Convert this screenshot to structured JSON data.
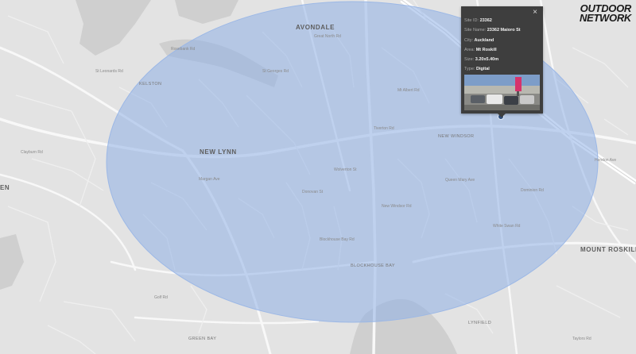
{
  "brand": {
    "line1": "OUTDOOR",
    "line2": "NETWORK"
  },
  "popup": {
    "rows": [
      {
        "key": "Site ID: ",
        "value": "23362"
      },
      {
        "key": "Site Name: ",
        "value": "23362 Maioro St"
      },
      {
        "key": "City: ",
        "value": "Auckland"
      },
      {
        "key": "Area: ",
        "value": "Mt Roskill"
      },
      {
        "key": "Size: ",
        "value": "3.20x5.40m"
      },
      {
        "key": "Type: ",
        "value": "Digital"
      }
    ],
    "close_glyph": "×"
  },
  "map": {
    "suburbs": {
      "avondale": "AVONDALE",
      "new_lynn": "NEW LYNN",
      "mount_roskill": "MOUNT ROSKILL",
      "blockhouse_bay": "BLOCKHOUSE BAY",
      "new_windsor": "NEW WINDSOR",
      "kelston": "KELSTON",
      "lynfield": "LYNFIELD",
      "green_bay": "GREEN BAY",
      "edge_en": "EN"
    },
    "streets": {
      "great_north_rd": "Great North Rd",
      "rosebank_rd": "Rosebank Rd",
      "st_georges_rd": "St Georges Rd",
      "wolverton_st": "Wolverton St",
      "st_leonards_rd": "St Leonards Rd",
      "clayburn_rd": "Clayburn Rd",
      "golf_rd": "Golf Rd",
      "tiverton_rd": "Tiverton Rd",
      "blockhouse_bay_rd": "Blockhouse Bay Rd",
      "margan_ave": "Margan Ave",
      "donovan_st": "Donovan St",
      "mt_albert_rd": "Mt Albert Rd",
      "dominion_rd": "Dominion Rd",
      "white_swan_rd": "White Swan Rd",
      "queen_mary_ave": "Queen Mary Ave",
      "new_windsor_rd": "New Windsor Rd",
      "taylors_rd": "Taylors Rd",
      "hendon_ave": "Hendon Ave"
    }
  },
  "colors": {
    "land": "#e3e3e3",
    "road": "#f7f7f7",
    "water": "#cfcfcf",
    "radius": "#8fb0e6",
    "popup_bg": "#3e3e3e"
  }
}
